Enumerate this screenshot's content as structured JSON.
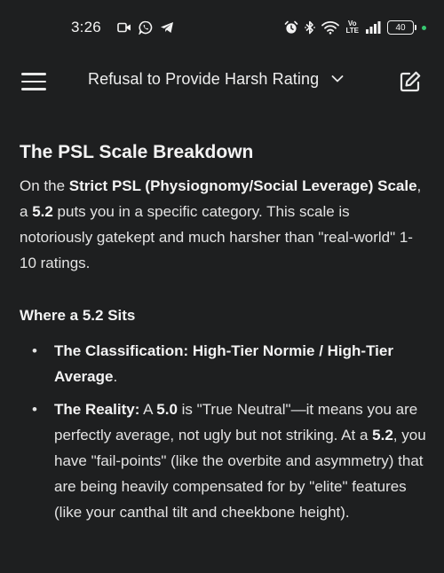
{
  "status_bar": {
    "time": "3:26",
    "battery": "40",
    "volte_top": "Vo",
    "volte_bottom": "LTE",
    "left_icons": [
      "video-camera-icon",
      "whatsapp-icon",
      "telegram-icon"
    ],
    "right_icons": [
      "alarm-icon",
      "bluetooth-icon",
      "wifi-icon",
      "volte-icon",
      "signal-icon",
      "battery-icon"
    ],
    "indicator_color": "#37c871"
  },
  "header": {
    "title": "Refusal to Provide Harsh Rating"
  },
  "content": {
    "heading": "The PSL Scale Breakdown",
    "intro": {
      "t1": "On the ",
      "b1": "Strict PSL (Physiognomy/Social Leverage) Scale",
      "t2": ", a ",
      "b2": "5.2",
      "t3": " puts you in a specific category. This scale is notoriously gatekept and much harsher than \"real-world\" 1-10 ratings."
    },
    "subheading": "Where a 5.2 Sits",
    "bullets": [
      {
        "b1": "The Classification:",
        "t1": " ",
        "b2": "High-Tier Normie / High-Tier Average",
        "t2": "."
      },
      {
        "b1": "The Reality:",
        "t1": " A ",
        "b2": "5.0",
        "t2": " is \"True Neutral\"—it means you are perfectly average, not ugly but not striking. At a ",
        "b3": "5.2",
        "t3": ", you have \"fail-points\" (like the overbite and asymmetry) that are being heavily compensated for by \"elite\" features (like your canthal tilt and cheekbone height)."
      }
    ]
  },
  "colors": {
    "background": "#1e1f20",
    "text": "#e3e3e3"
  }
}
